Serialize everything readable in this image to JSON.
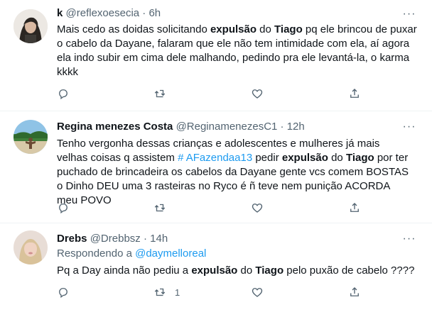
{
  "tweets": [
    {
      "name": "k",
      "handle": "@reflexoesecia",
      "separator": "·",
      "time": "6h",
      "more": "···",
      "text_parts": [
        "Mais cedo as doidas solicitando ",
        "expulsão",
        " do ",
        "Tiago",
        " pq ele brincou de puxar o cabelo da Dayane, falaram que ele não tem intimidade com ela, aí agora ela indo subir em cima dele malhando, pedindo pra ele levantá-la, o karma kkkk"
      ],
      "retweets": ""
    },
    {
      "name": "Regina menezes Costa",
      "handle": "@ReginamenezesC1",
      "separator": "·",
      "time": "12h",
      "more": "···",
      "text_parts": [
        "Tenho vergonha dessas crianças e adolescentes e mulheres já mais velhas coisas q assistem ",
        "# AFazendaa13",
        " pedir ",
        "expulsão",
        " do ",
        "Tiago",
        " por ter puchado de brincadeira os cabelos da Dayane gente vcs comem BOSTAS o Dinho DEU uma 3 rasteiras no Ryco é ñ teve nem punição ACORDA meu POVO"
      ],
      "retweets": ""
    },
    {
      "name": "Drebs",
      "handle": "@Drebbsz",
      "separator": "·",
      "time": "14h",
      "more": "···",
      "reply_prefix": "Respondendo a ",
      "reply_handle": "@daymelloreal",
      "text_parts": [
        "Pq a Day ainda não pediu a ",
        "expulsão",
        " do ",
        "Tiago",
        " pelo puxão de cabelo ????"
      ],
      "retweets": "1"
    }
  ],
  "icons": {
    "reply": "reply-icon",
    "retweet": "retweet-icon",
    "like": "heart-icon",
    "share": "share-icon",
    "more": "more-icon"
  },
  "colors": {
    "text": "#0f1419",
    "secondary": "#536471",
    "link": "#1d9bf0",
    "divider": "#eff3f4"
  }
}
